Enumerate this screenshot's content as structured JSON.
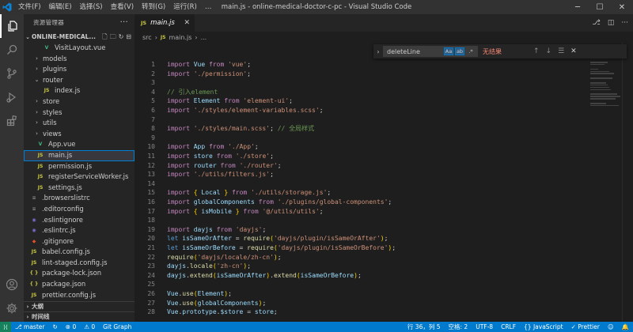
{
  "titlebar": {
    "menu": [
      "文件(F)",
      "编辑(E)",
      "选择(S)",
      "查看(V)",
      "转到(G)",
      "运行(R)",
      "…"
    ],
    "title": "main.js - online-medical-doctor-c-pc - Visual Studio Code",
    "min": "─",
    "max": "☐",
    "close": "✕"
  },
  "sidebar": {
    "header": "资源管理器",
    "more": "···",
    "folder": "ONLINE-MEDICAL...",
    "tree": [
      {
        "label": "VisitLayout.vue",
        "type": "vue",
        "indent": 2,
        "icon": "V",
        "color": "#41b883"
      },
      {
        "label": "models",
        "type": "folder",
        "indent": 1,
        "chev": "›"
      },
      {
        "label": "plugins",
        "type": "folder",
        "indent": 1,
        "chev": "›"
      },
      {
        "label": "router",
        "type": "folder",
        "indent": 1,
        "chev": "⌄"
      },
      {
        "label": "index.js",
        "type": "js",
        "indent": 2,
        "icon": "JS",
        "color": "#cbcb41"
      },
      {
        "label": "store",
        "type": "folder",
        "indent": 1,
        "chev": "›"
      },
      {
        "label": "styles",
        "type": "folder",
        "indent": 1,
        "chev": "›"
      },
      {
        "label": "utils",
        "type": "folder",
        "indent": 1,
        "chev": "›"
      },
      {
        "label": "views",
        "type": "folder",
        "indent": 1,
        "chev": "›"
      },
      {
        "label": "App.vue",
        "type": "vue",
        "indent": 1,
        "icon": "V",
        "color": "#41b883"
      },
      {
        "label": "main.js",
        "type": "js",
        "indent": 1,
        "icon": "JS",
        "color": "#cbcb41",
        "selected": true
      },
      {
        "label": "permission.js",
        "type": "js",
        "indent": 1,
        "icon": "JS",
        "color": "#cbcb41"
      },
      {
        "label": "registerServiceWorker.js",
        "type": "js",
        "indent": 1,
        "icon": "JS",
        "color": "#cbcb41"
      },
      {
        "label": "settings.js",
        "type": "js",
        "indent": 1,
        "icon": "JS",
        "color": "#cbcb41"
      },
      {
        "label": ".browserslistrc",
        "type": "cfg",
        "indent": 0,
        "icon": "≡",
        "color": "#8a8a8a"
      },
      {
        "label": ".editorconfig",
        "type": "cfg",
        "indent": 0,
        "icon": "≡",
        "color": "#8a8a8a"
      },
      {
        "label": ".eslintignore",
        "type": "cfg",
        "indent": 0,
        "icon": "◉",
        "color": "#7a6fcf"
      },
      {
        "label": ".eslintrc.js",
        "type": "cfg",
        "indent": 0,
        "icon": "◉",
        "color": "#7a6fcf"
      },
      {
        "label": ".gitignore",
        "type": "cfg",
        "indent": 0,
        "icon": "◆",
        "color": "#e44d26"
      },
      {
        "label": "babel.config.js",
        "type": "js",
        "indent": 0,
        "icon": "JS",
        "color": "#cbcb41"
      },
      {
        "label": "lint-staged.config.js",
        "type": "js",
        "indent": 0,
        "icon": "JS",
        "color": "#cbcb41"
      },
      {
        "label": "package-lock.json",
        "type": "json",
        "indent": 0,
        "icon": "{ }",
        "color": "#cbcb41"
      },
      {
        "label": "package.json",
        "type": "json",
        "indent": 0,
        "icon": "{ }",
        "color": "#cbcb41"
      },
      {
        "label": "prettier.config.js",
        "type": "js",
        "indent": 0,
        "icon": "JS",
        "color": "#cbcb41"
      }
    ],
    "outline": "大纲",
    "timeline": "时间线"
  },
  "editor": {
    "tab_label": "main.js",
    "tab_icon": "JS",
    "breadcrumb": [
      "src",
      "›",
      "main.js",
      "›",
      "..."
    ],
    "lines": [
      {
        "n": "1",
        "html": "<span class='kw'>import</span> <span class='var'>Vue</span> <span class='kw'>from</span> <span class='str'>'vue'</span>;"
      },
      {
        "n": "2",
        "html": "<span class='kw'>import</span> <span class='str'>'./permission'</span>;"
      },
      {
        "n": "3",
        "html": ""
      },
      {
        "n": "4",
        "html": "<span class='cmt'>// 引入element</span>"
      },
      {
        "n": "5",
        "html": "<span class='kw'>import</span> <span class='var'>Element</span> <span class='kw'>from</span> <span class='str'>'element-ui'</span>;"
      },
      {
        "n": "6",
        "html": "<span class='kw'>import</span> <span class='str'>'./styles/element-variables.scss'</span>;"
      },
      {
        "n": "7",
        "html": ""
      },
      {
        "n": "8",
        "html": "<span class='kw'>import</span> <span class='str'>'./styles/main.scss'</span>; <span class='cmt'>// 全局样式</span>"
      },
      {
        "n": "9",
        "html": ""
      },
      {
        "n": "10",
        "html": "<span class='kw'>import</span> <span class='var'>App</span> <span class='kw'>from</span> <span class='str'>'./App'</span>;"
      },
      {
        "n": "11",
        "html": "<span class='kw'>import</span> <span class='var'>store</span> <span class='kw'>from</span> <span class='str'>'./store'</span>;"
      },
      {
        "n": "12",
        "html": "<span class='kw'>import</span> <span class='var'>router</span> <span class='kw'>from</span> <span class='str'>'./router'</span>;"
      },
      {
        "n": "13",
        "html": "<span class='kw'>import</span> <span class='str'>'./utils/filters.js'</span>;"
      },
      {
        "n": "14",
        "html": ""
      },
      {
        "n": "15",
        "html": "<span class='kw'>import</span> <span class='brk'>{</span> <span class='var'>Local</span> <span class='brk'>}</span> <span class='kw'>from</span> <span class='str'>'./utils/storage.js'</span>;"
      },
      {
        "n": "16",
        "html": "<span class='kw'>import</span> <span class='var'>globalComponents</span> <span class='kw'>from</span> <span class='str'>'./plugins/global-components'</span>;"
      },
      {
        "n": "17",
        "html": "<span class='kw'>import</span> <span class='brk'>{</span> <span class='var'>isMobile</span> <span class='brk'>}</span> <span class='kw'>from</span> <span class='str'>'@/utils/utils'</span>;"
      },
      {
        "n": "18",
        "html": ""
      },
      {
        "n": "19",
        "html": "<span class='kw'>import</span> <span class='var'>dayjs</span> <span class='kw'>from</span> <span class='str'>'dayjs'</span>;"
      },
      {
        "n": "20",
        "html": "<span class='kw2'>let</span> <span class='var'>isSameOrAfter</span> = <span class='fn'>require</span><span class='brk'>(</span><span class='str'>'dayjs/plugin/isSameOrAfter'</span><span class='brk'>)</span>;"
      },
      {
        "n": "21",
        "html": "<span class='kw2'>let</span> <span class='var'>isSameOrBefore</span> = <span class='fn'>require</span><span class='brk'>(</span><span class='str'>'dayjs/plugin/isSameOrBefore'</span><span class='brk'>)</span>;"
      },
      {
        "n": "22",
        "html": "<span class='fn'>require</span><span class='brk'>(</span><span class='str'>'dayjs/locale/zh-cn'</span><span class='brk'>)</span>;"
      },
      {
        "n": "23",
        "html": "<span class='var'>dayjs</span>.<span class='fn'>locale</span><span class='brk'>(</span><span class='str'>'zh-cn'</span><span class='brk'>)</span>;"
      },
      {
        "n": "24",
        "html": "<span class='var'>dayjs</span>.<span class='fn'>extend</span><span class='brk'>(</span><span class='var'>isSameOrAfter</span><span class='brk'>)</span>.<span class='fn'>extend</span><span class='brk'>(</span><span class='var'>isSameOrBefore</span><span class='brk'>)</span>;"
      },
      {
        "n": "25",
        "html": ""
      },
      {
        "n": "26",
        "html": "<span class='var'>Vue</span>.<span class='fn'>use</span><span class='brk'>(</span><span class='var'>Element</span><span class='brk'>)</span>;"
      },
      {
        "n": "27",
        "html": "<span class='var'>Vue</span>.<span class='fn'>use</span><span class='brk'>(</span><span class='var'>globalComponents</span><span class='brk'>)</span>;"
      },
      {
        "n": "28",
        "html": "<span class='var'>Vue</span>.<span class='var'>prototype</span>.<span class='var'>$store</span> = <span class='var'>store</span>;"
      }
    ]
  },
  "find": {
    "value": "deleteLine",
    "opt_case": "Aa",
    "opt_word": "ab",
    "opt_regex": ".*",
    "result": "无结果",
    "up": "↑",
    "down": "↓",
    "selection": "☰",
    "close": "✕"
  },
  "statusbar": {
    "branch": "master",
    "errors": "⊗ 0",
    "warnings": "⚠ 0",
    "git_graph": "Git Graph",
    "position": "行 36，列 5",
    "spaces": "空格: 2",
    "encoding": "UTF-8",
    "eol": "CRLF",
    "language": "{} JavaScript",
    "prettier": "✓ Prettier"
  }
}
